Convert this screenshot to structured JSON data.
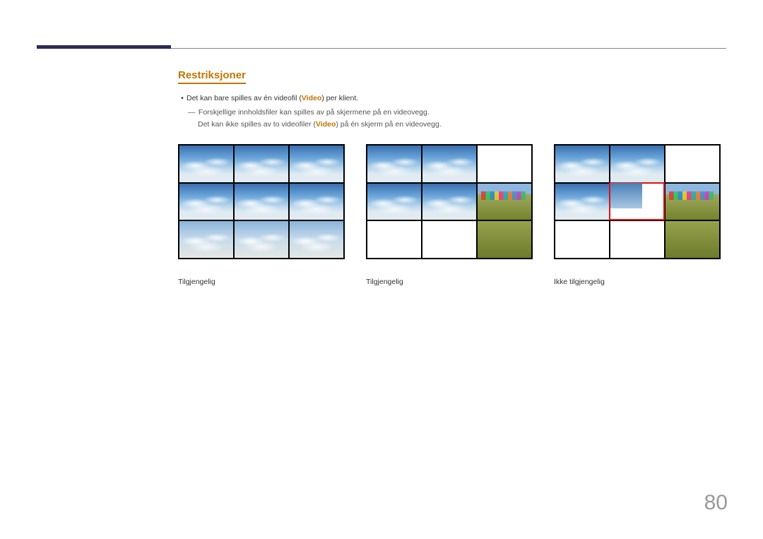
{
  "section": {
    "heading": "Restriksjoner",
    "bullet_prefix": "Det kan bare spilles av én videofil (",
    "bullet_em": "Video",
    "bullet_suffix": ") per klient.",
    "note1": "Forskjellige innholdsfiler kan spilles av på skjermene på en videovegg.",
    "note2_prefix": "Det kan ikke spilles av to videofiler (",
    "note2_em": "Video",
    "note2_suffix": ") på én skjerm på en videovegg."
  },
  "figures": {
    "caption1": "Tilgjengelig",
    "caption2": "Tilgjengelig",
    "caption3": "Ikke tilgjengelig"
  },
  "page_number": "80"
}
